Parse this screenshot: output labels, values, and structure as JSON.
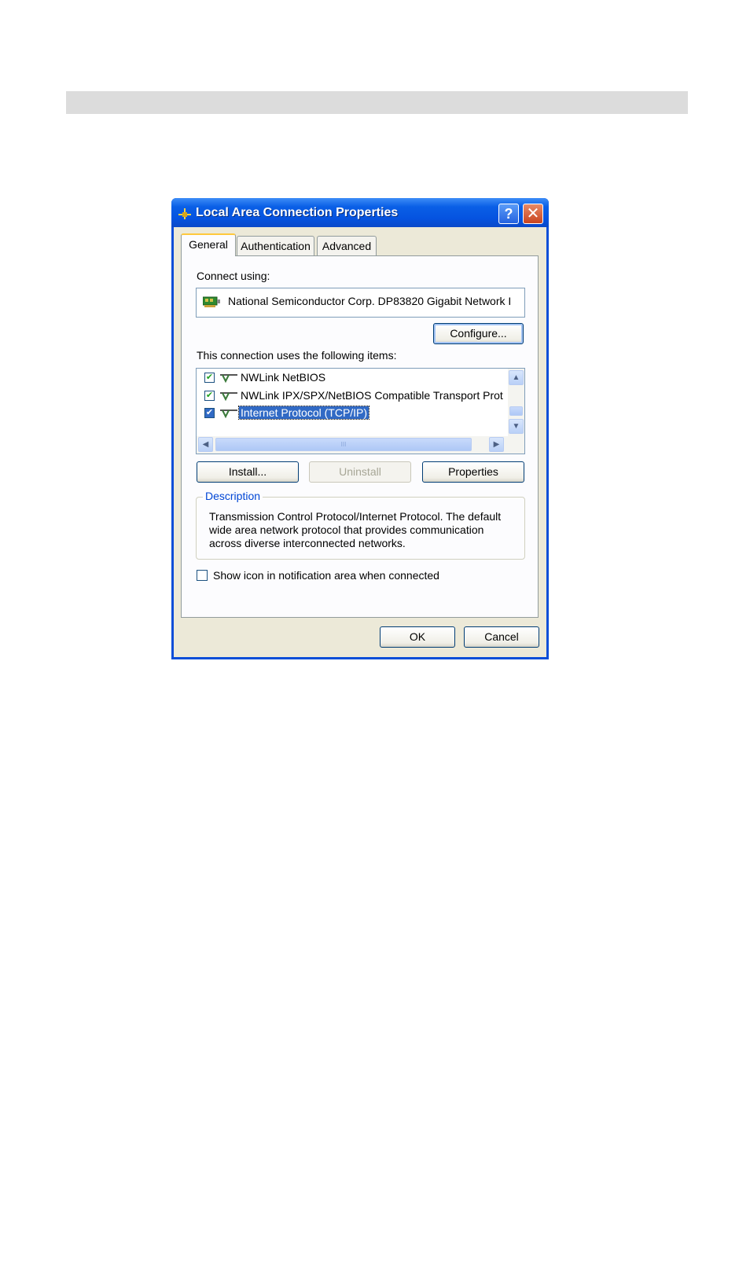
{
  "dialog": {
    "title": "Local Area Connection Properties",
    "help_glyph": "?",
    "close_glyph": "✕"
  },
  "tabs": [
    {
      "label": "General",
      "active": true
    },
    {
      "label": "Authentication",
      "active": false
    },
    {
      "label": "Advanced",
      "active": false
    }
  ],
  "general": {
    "connect_using_label": "Connect using:",
    "adapter_name": "National Semiconductor Corp. DP83820 Gigabit Network I",
    "configure_label": "Configure...",
    "items_label": "This connection uses the following items:",
    "items": [
      {
        "label": "NWLink NetBIOS",
        "checked": true,
        "selected": false
      },
      {
        "label": "NWLink IPX/SPX/NetBIOS Compatible Transport Prot",
        "checked": true,
        "selected": false
      },
      {
        "label": "Internet Protocol (TCP/IP)",
        "checked": true,
        "selected": true
      }
    ],
    "check_glyph": "✔",
    "scroll": {
      "up": "▲",
      "down": "▼",
      "left": "◀",
      "right": "▶",
      "grip": "III"
    },
    "install_label": "Install...",
    "uninstall_label": "Uninstall",
    "properties_label": "Properties",
    "description_title": "Description",
    "description_text": "Transmission Control Protocol/Internet Protocol. The default wide area network protocol that provides communication across diverse interconnected networks.",
    "show_icon_label": "Show icon in notification area when connected",
    "show_icon_checked": false
  },
  "footer": {
    "ok_label": "OK",
    "cancel_label": "Cancel"
  },
  "colors": {
    "titlebar": "#0553e0",
    "selection": "#316ac5",
    "client": "#ece9d8",
    "group_title": "#0046d5"
  }
}
